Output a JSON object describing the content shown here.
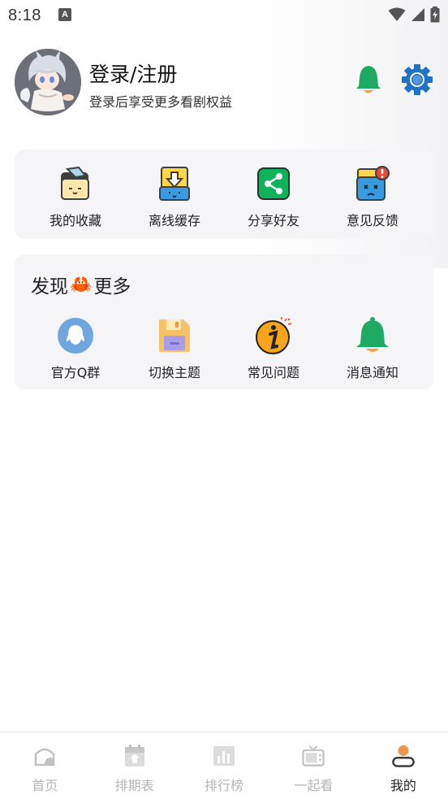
{
  "status_bar": {
    "time": "8:18",
    "notification_icon_letter": "A"
  },
  "profile": {
    "title": "登录/注册",
    "subtitle": "登录后享受更多看剧权益",
    "notification_icon": "bell-icon",
    "settings_icon": "gear-icon"
  },
  "quick_actions": {
    "items": [
      {
        "label": "我的收藏",
        "icon": "folder-favorites-icon"
      },
      {
        "label": "离线缓存",
        "icon": "download-cache-icon"
      },
      {
        "label": "分享好友",
        "icon": "share-icon"
      },
      {
        "label": "意见反馈",
        "icon": "feedback-icon"
      }
    ]
  },
  "discover": {
    "title_before": "发现",
    "title_emoji": "🦀",
    "title_after": "更多",
    "items": [
      {
        "label": "官方Q群",
        "icon": "qq-group-icon"
      },
      {
        "label": "切换主题",
        "icon": "theme-save-icon"
      },
      {
        "label": "常见问题",
        "icon": "info-icon"
      },
      {
        "label": "消息通知",
        "icon": "bell-icon"
      }
    ]
  },
  "bottom_nav": {
    "items": [
      {
        "label": "首页",
        "icon": "home-icon",
        "active": false
      },
      {
        "label": "排期表",
        "icon": "calendar-icon",
        "active": false
      },
      {
        "label": "排行榜",
        "icon": "ranking-icon",
        "active": false
      },
      {
        "label": "一起看",
        "icon": "tv-icon",
        "active": false
      },
      {
        "label": "我的",
        "icon": "profile-icon",
        "active": true
      }
    ]
  },
  "colors": {
    "accent_green": "#1daa63",
    "gear_blue": "#1e73c8",
    "card_bg": "#f5f5f7",
    "nav_inactive": "#b5b5b5",
    "nav_active": "#222222"
  }
}
